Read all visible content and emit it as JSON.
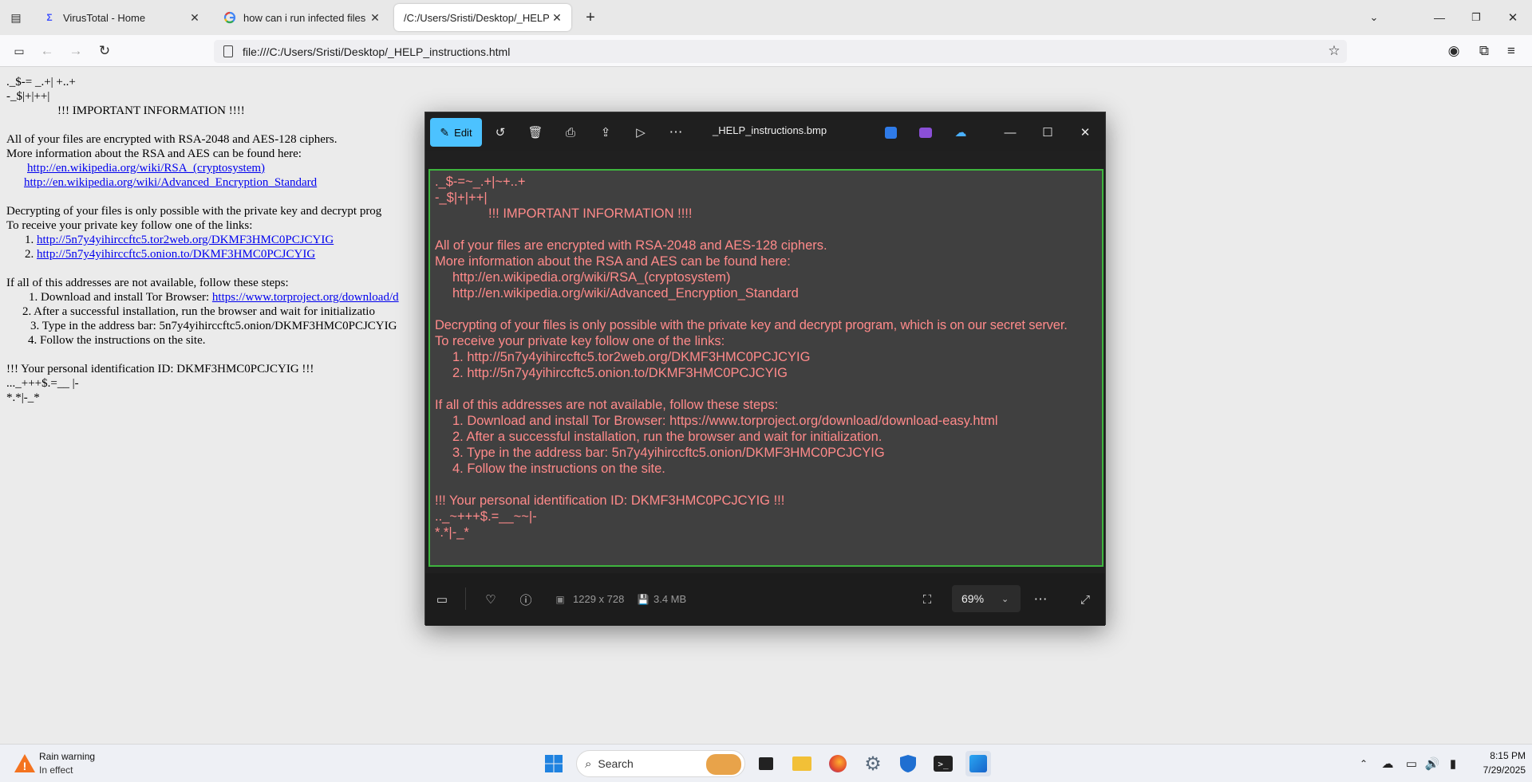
{
  "browser": {
    "tabs": [
      {
        "title": "VirusTotal - Home",
        "active": false
      },
      {
        "title": "how can i run infected files in w",
        "active": false
      },
      {
        "title": "/C:/Users/Sristi/Desktop/_HELP_inst",
        "active": true
      }
    ],
    "url": "file:///C:/Users/Sristi/Desktop/_HELP_instructions.html"
  },
  "page": {
    "lines": [
      "._$-= _.+| +..+",
      "-_$|+|++|",
      "!!! IMPORTANT INFORMATION !!!!",
      "All  of  your  files  are encrypted  with RSA-2048  and AES-128  ciphers.",
      "More information about the  RSA  and  AES can be  found  here:",
      "Decrypting of your  files  is only  possible with the  private  key  and  decrypt prog",
      "To  receive  your  private  key  follow one  of  the links:",
      "If  all of this addresses  are  not available, follow  these  steps:",
      "!!!  Your  personal identification ID: DKMF3HMC0PCJCYIG !!!",
      "..._+++$.=__  |-",
      "*.*|-_*"
    ],
    "links": [
      "http://en.wikipedia.org/wiki/RSA_(cryptosystem)",
      "http://en.wikipedia.org/wiki/Advanced_Encryption_Standard",
      "http://5n7y4yihirccftc5.tor2web.org/DKMF3HMC0PCJCYIG",
      "http://5n7y4yihirccftc5.onion.to/DKMF3HMC0PCJCYIG",
      "https://www.torproject.org/download/d"
    ],
    "list_prefixes": [
      "1.",
      "2."
    ],
    "steps": [
      "1. Download and  install  Tor Browser:",
      "2.  After  a  successful  installation,  run  the browser  and wait for  initializatio",
      "3.  Type in  the address bar: 5n7y4yihirccftc5.onion/DKMF3HMC0PCJCYIG",
      "4.  Follow  the  instructions  on the site."
    ]
  },
  "viewer": {
    "edit_label": "Edit",
    "filename": "_HELP_instructions.bmp",
    "dimensions": "1229 x 728",
    "filesize": "3.4 MB",
    "zoom": "69%",
    "text_color": "#ff8a8a",
    "border_color": "#3eb53e",
    "ransom_lines": [
      "._$-=~_.+|~+..+",
      "-_$|+|++|",
      "!!! IMPORTANT INFORMATION !!!!",
      "All of your files are encrypted with RSA-2048 and AES-128 ciphers.",
      "More information about the RSA and AES can be found here:",
      "http://en.wikipedia.org/wiki/RSA_(cryptosystem)",
      "http://en.wikipedia.org/wiki/Advanced_Encryption_Standard",
      "Decrypting of your files is only possible with the private key and decrypt program, which is on our secret server.",
      "To receive your private key follow one of the links:",
      "1. http://5n7y4yihirccftc5.tor2web.org/DKMF3HMC0PCJCYIG",
      "2. http://5n7y4yihirccftc5.onion.to/DKMF3HMC0PCJCYIG",
      "If all of this addresses are not available, follow these steps:",
      "1. Download and install Tor Browser: https://www.torproject.org/download/download-easy.html",
      "2. After a successful installation, run the browser and wait for initialization.",
      "3. Type in the address bar: 5n7y4yihirccftc5.onion/DKMF3HMC0PCJCYIG",
      "4. Follow the instructions on the site.",
      "!!! Your personal identification ID: DKMF3HMC0PCJCYIG !!!",
      ".._~+++$.=__~~|-",
      "*.*|-_*"
    ]
  },
  "taskbar": {
    "weather_title": "Rain warning",
    "weather_sub": "In effect",
    "search_placeholder": "Search",
    "time": "8:15 PM",
    "date": "7/29/2025"
  }
}
